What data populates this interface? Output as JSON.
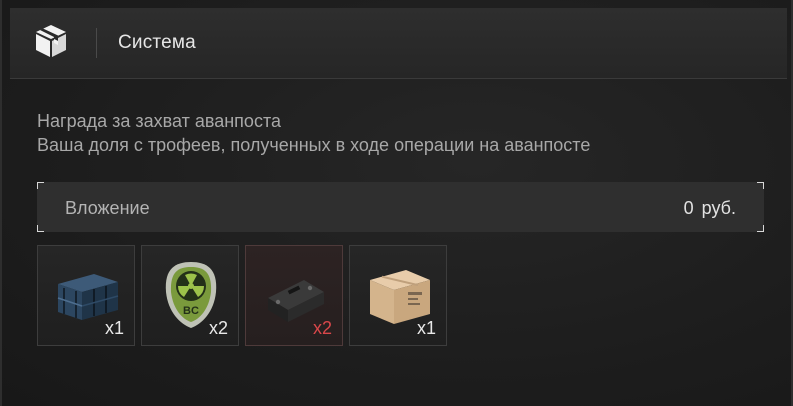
{
  "header": {
    "icon": "package-icon",
    "title": "Система"
  },
  "message": {
    "line1": "Награда за захват аванпоста",
    "line2": "Ваша доля с трофеев, полученных в ходе операции на аванпосте"
  },
  "investment": {
    "label": "Вложение",
    "value": "0 руб."
  },
  "items": [
    {
      "icon": "blue-crate-icon",
      "quantity": "x1",
      "quantity_color": "#e8e8e8"
    },
    {
      "icon": "radiation-patch-icon",
      "quantity": "x2",
      "quantity_color": "#e8e8e8"
    },
    {
      "icon": "ammo-box-icon",
      "quantity": "x2",
      "quantity_color": "#d9474a"
    },
    {
      "icon": "cardboard-box-icon",
      "quantity": "x1",
      "quantity_color": "#e8e8e8"
    }
  ]
}
